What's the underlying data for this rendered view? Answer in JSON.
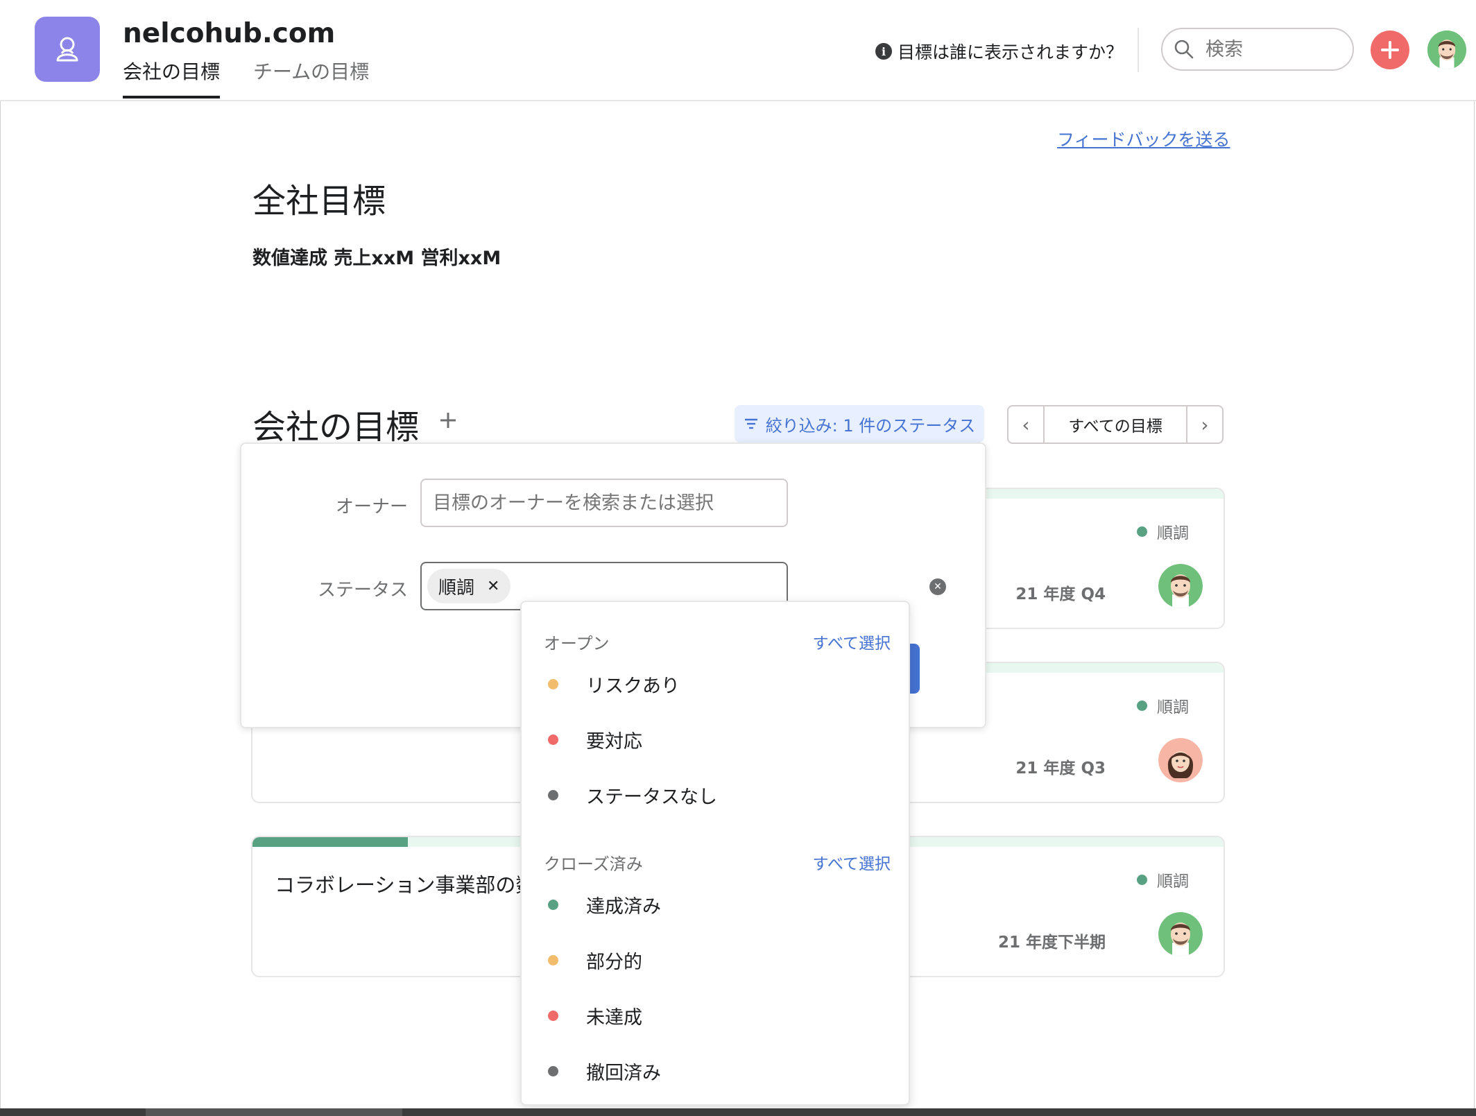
{
  "header": {
    "org_name": "nelcohub.com",
    "tabs": [
      {
        "label": "会社の目標",
        "active": true
      },
      {
        "label": "チームの目標",
        "active": false
      }
    ],
    "who_sees": "目標は誰に表示されますか？",
    "search_placeholder": "検索"
  },
  "main": {
    "feedback_link": "フィードバックを送る",
    "mission_title": "全社目標",
    "mission_text": "数値達成 売上xxM 営利xxM",
    "section_title": "会社の目標",
    "filter_button": "絞り込み: 1 件のステータス",
    "pager_label": "すべての目標"
  },
  "goals": [
    {
      "name": "",
      "status": "順調",
      "period": "21 年度 Q4",
      "progress": 0
    },
    {
      "name": "",
      "status": "順調",
      "period": "21 年度 Q3",
      "progress": 0
    },
    {
      "name": "コラボレーション事業部の数",
      "status": "順調",
      "period": "21 年度下半期",
      "progress": 0.16
    }
  ],
  "filter": {
    "owner_label": "オーナー",
    "owner_placeholder": "目標のオーナーを検索または選択",
    "status_label": "ステータス",
    "status_chip": "順調"
  },
  "dropdown": {
    "open_group": {
      "title": "オープン",
      "select_all": "すべて選択"
    },
    "open_items": [
      {
        "label": "リスクあり",
        "color": "#f1bd6c"
      },
      {
        "label": "要対応",
        "color": "#f06a6a"
      },
      {
        "label": "ステータスなし",
        "color": "#6d6e6f"
      }
    ],
    "closed_group": {
      "title": "クローズ済み",
      "select_all": "すべて選択"
    },
    "closed_items": [
      {
        "label": "達成済み",
        "color": "#58a182"
      },
      {
        "label": "部分的",
        "color": "#f1bd6c"
      },
      {
        "label": "未達成",
        "color": "#f06a6a"
      },
      {
        "label": "撤回済み",
        "color": "#6d6e6f"
      }
    ]
  },
  "colors": {
    "on_track": "#58a182",
    "accent": "#4573d2",
    "brand": "#8c84e8",
    "add": "#f06a6a"
  }
}
